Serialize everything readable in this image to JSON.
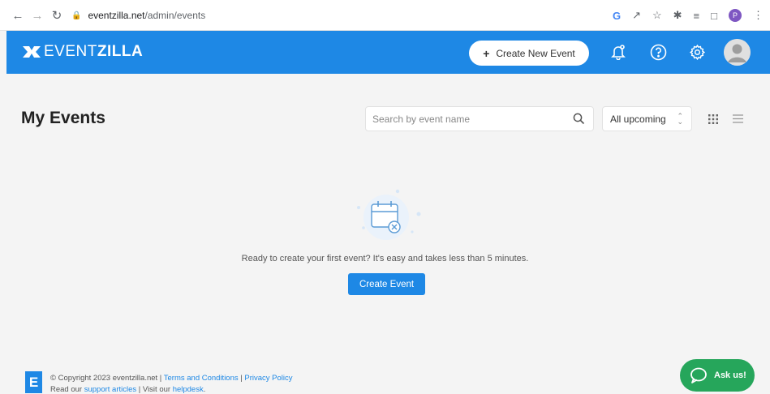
{
  "browser": {
    "url_domain": "eventzilla.net",
    "url_path": "/admin/events",
    "profile_initial": "P"
  },
  "header": {
    "logo_light": "EVENT",
    "logo_bold": "ZILLA",
    "create_new_label": "Create New Event",
    "icons": [
      "bell-icon",
      "help-icon",
      "gear-icon",
      "avatar"
    ]
  },
  "main": {
    "title": "My Events",
    "search_placeholder": "Search by event name",
    "filter_value": "All upcoming",
    "empty_message": "Ready to create your first event? It's easy and takes less than 5 minutes.",
    "create_event_label": "Create Event"
  },
  "footer": {
    "logo_letter": "E",
    "copyright": "© Copyright 2023 eventzilla.net | ",
    "terms": "Terms and Conditions",
    "sep": " | ",
    "privacy": "Privacy Policy",
    "read_our": "Read our ",
    "support": "support articles",
    "visit": " | Visit our ",
    "helpdesk": "helpdesk",
    "period": "."
  },
  "chat": {
    "label": "Ask us!"
  },
  "colors": {
    "brand_blue": "#1e88e5",
    "chat_green": "#26a65b"
  }
}
